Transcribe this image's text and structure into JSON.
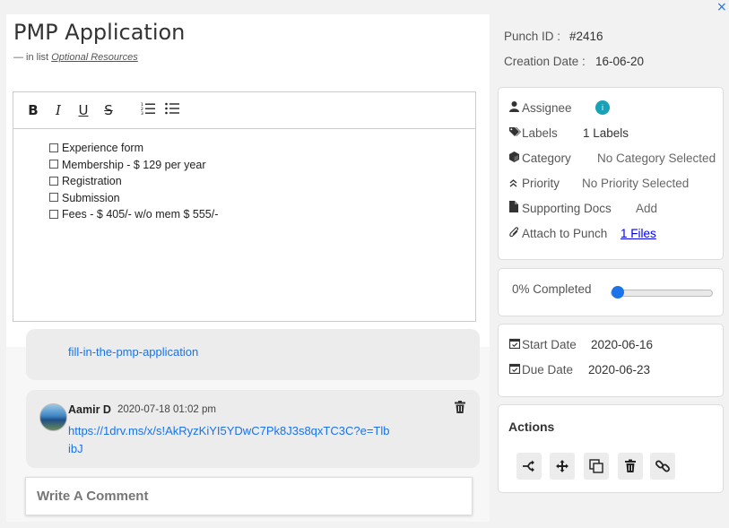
{
  "title": "PMP Application",
  "in_list": {
    "prefix": "— in list",
    "link": "Optional Resources"
  },
  "toolbar": {
    "bold": "B",
    "italic": "I",
    "underline": "U",
    "strike": "S"
  },
  "checklist": [
    "Experience form",
    "Membership - $ 129 per year",
    "Registration",
    "Submission",
    "Fees - $ 405/- w/o mem $ 555/-"
  ],
  "comments": [
    {
      "link": "fill-in-the-pmp-application"
    },
    {
      "author": "Aamir D",
      "time": "2020-07-18 01:02 pm",
      "link": "https://1drv.ms/x/s!AkRyzKiYI5YDwC7Pk8J3s8qxTC3C?e=TlbibJ"
    }
  ],
  "comment_input": {
    "placeholder": "Write A Comment"
  },
  "close_label": "×",
  "punch": {
    "id_label": "Punch ID :",
    "id_value": "#2416",
    "date_label": "Creation Date :",
    "date_value": "16-06-20"
  },
  "details": {
    "assignee_label": "Assignee",
    "assignee_initial": "i",
    "labels_label": "Labels",
    "labels_value": "1 Labels",
    "category_label": "Category",
    "category_value": "No Category Selected",
    "priority_label": "Priority",
    "priority_value": "No Priority Selected",
    "docs_label": "Supporting Docs",
    "docs_value": "Add",
    "attach_label": "Attach to Punch",
    "attach_value": "1 Files"
  },
  "progress": {
    "label": "0% Completed",
    "value": 0
  },
  "dates": {
    "start_label": "Start Date",
    "start_value": "2020-06-16",
    "due_label": "Due Date",
    "due_value": "2020-06-23"
  },
  "actions": {
    "title": "Actions",
    "buttons": [
      "split-icon",
      "move-icon",
      "copy-icon",
      "trash-icon",
      "link-icon"
    ]
  },
  "colors": {
    "accent": "#1a73e8",
    "assignee_badge": "#17a2b8"
  }
}
